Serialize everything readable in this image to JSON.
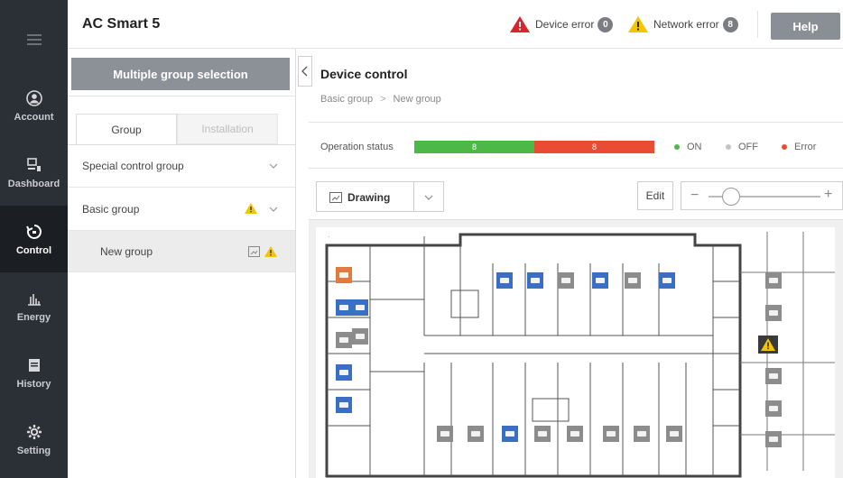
{
  "nav": {
    "items": [
      {
        "label": "Account",
        "icon": "account-icon"
      },
      {
        "label": "Dashboard",
        "icon": "dashboard-icon"
      },
      {
        "label": "Control",
        "icon": "control-icon",
        "active": true
      },
      {
        "label": "Energy",
        "icon": "energy-icon"
      },
      {
        "label": "History",
        "icon": "history-icon"
      },
      {
        "label": "Setting",
        "icon": "gear-icon"
      }
    ]
  },
  "header": {
    "app_title": "AC Smart 5",
    "device_error_label": "Device error",
    "device_error_count": "0",
    "network_error_label": "Network error",
    "network_error_count": "8",
    "help_label": "Help"
  },
  "group_panel": {
    "multi_select_label": "Multiple group selection",
    "tabs": [
      {
        "label": "Group",
        "active": true
      },
      {
        "label": "Installation",
        "active": false
      }
    ],
    "tree": [
      {
        "label": "Special control group",
        "warning": false
      },
      {
        "label": "Basic group",
        "warning": true
      },
      {
        "label": "New group",
        "warning": true,
        "selected": true
      }
    ]
  },
  "main": {
    "title": "Device control",
    "breadcrumb": [
      "Basic group",
      "New group"
    ],
    "operation_status_label": "Operation status",
    "status_bar": {
      "on_count": "8",
      "error_count": "8",
      "on_fraction": 0.5
    },
    "legend": [
      {
        "label": "ON",
        "color": "#4cb848"
      },
      {
        "label": "OFF",
        "color": "#c4c4c4"
      },
      {
        "label": "Error",
        "color": "#e94b35"
      }
    ],
    "view_selector_label": "Drawing",
    "edit_label": "Edit",
    "zoom_level": 0.2
  },
  "colors": {
    "nav_bg": "#2b2f36",
    "nav_active": "#1b1e23",
    "on_green": "#4cb848",
    "error_red": "#e94b35",
    "warning_yellow": "#f5c400",
    "unit_on_blue": "#3b6fc4",
    "unit_off_gray": "#8c8c8c"
  }
}
